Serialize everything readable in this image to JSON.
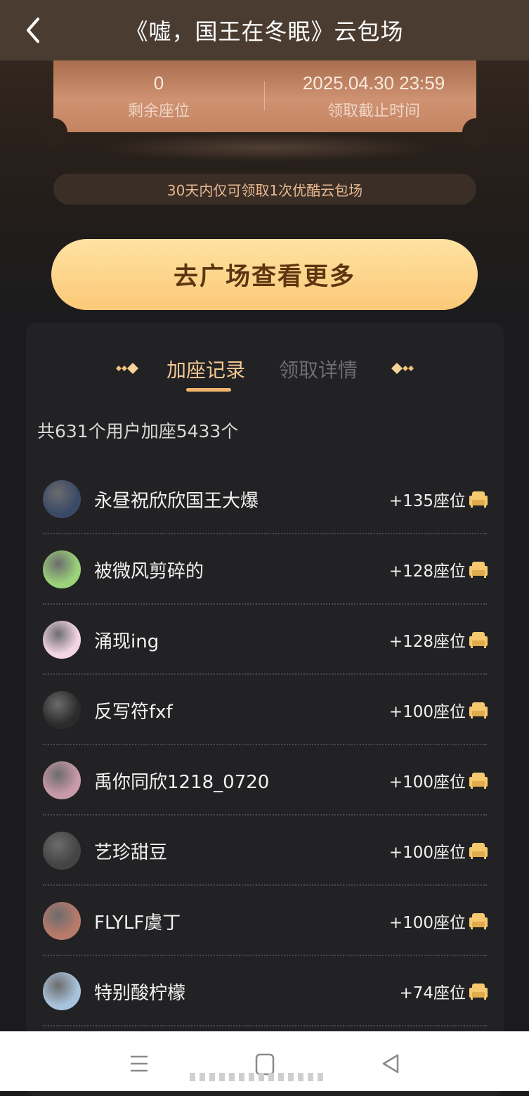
{
  "header": {
    "title": "《嘘，国王在冬眠》云包场"
  },
  "ticket": {
    "remaining_value": "0",
    "remaining_label": "剩余座位",
    "deadline_value": "2025.04.30 23:59",
    "deadline_label": "领取截止时间"
  },
  "limit_notice": "30天内仅可领取1次优酷云包场",
  "cta_label": "去广场查看更多",
  "tabs": [
    {
      "label": "加座记录",
      "active": true
    },
    {
      "label": "领取详情",
      "active": false
    }
  ],
  "summary": "共631个用户加座5433个",
  "records": [
    {
      "name": "永昼祝欣欣国王大爆",
      "seats": "+135座位",
      "avatar_color": "#3a4a66"
    },
    {
      "name": "被微风剪碎的",
      "seats": "+128座位",
      "avatar_color": "#9bd27a"
    },
    {
      "name": "涌现ing",
      "seats": "+128座位",
      "avatar_color": "#f3d6e2"
    },
    {
      "name": "反写符fxf",
      "seats": "+100座位",
      "avatar_color": "#2b2b2b"
    },
    {
      "name": "禹你同欣1218_0720",
      "seats": "+100座位",
      "avatar_color": "#c99aa8"
    },
    {
      "name": "艺珍甜豆",
      "seats": "+100座位",
      "avatar_color": "#444444"
    },
    {
      "name": "FLYLF虞丁",
      "seats": "+100座位",
      "avatar_color": "#b87a6a"
    },
    {
      "name": "特别酸柠檬",
      "seats": "+74座位",
      "avatar_color": "#a9c3dc"
    }
  ],
  "colors": {
    "accent_gold": "#f3c792",
    "cta_top": "#ffe2a3",
    "cta_bottom": "#fbc977",
    "sofa": "#f6c96e"
  }
}
